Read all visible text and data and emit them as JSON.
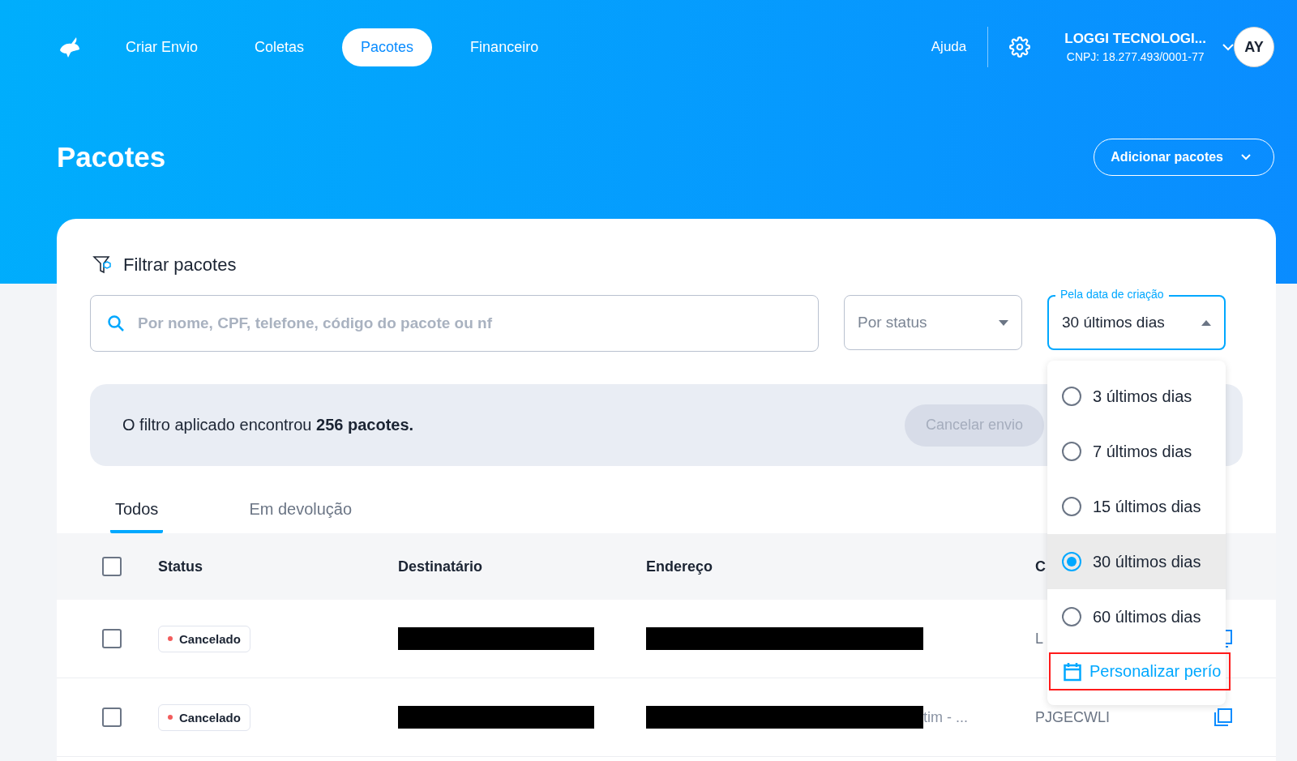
{
  "nav": {
    "items": [
      {
        "label": "Criar Envio",
        "selected": false
      },
      {
        "label": "Coletas",
        "selected": false
      },
      {
        "label": "Pacotes",
        "selected": true
      },
      {
        "label": "Financeiro",
        "selected": false
      }
    ],
    "help": "Ajuda",
    "company": {
      "name": "LOGGI TECNOLOGI...",
      "cnpj": "CNPJ: 18.277.493/0001-77"
    },
    "avatar": "AY"
  },
  "page": {
    "title": "Pacotes",
    "add_button": "Adicionar pacotes"
  },
  "filter": {
    "title": "Filtrar pacotes",
    "search": {
      "placeholder": "Por nome, CPF, telefone, código do pacote ou nf"
    },
    "status_select": {
      "placeholder": "Por status"
    },
    "date_select": {
      "label": "Pela data de criação",
      "value": "30 últimos dias",
      "expanded": true,
      "options": [
        {
          "label": "3 últimos dias",
          "selected": false
        },
        {
          "label": "7 últimos dias",
          "selected": false
        },
        {
          "label": "15 últimos dias",
          "selected": false
        },
        {
          "label": "30 últimos dias",
          "selected": true
        },
        {
          "label": "60 últimos dias",
          "selected": false
        }
      ],
      "custom": {
        "label": "Personalizar perío",
        "highlighted": true
      }
    }
  },
  "result": {
    "text": "O filtro aplicado encontrou **256 pacotes.**",
    "cancel_button": {
      "label": "Cancelar envio",
      "disabled": true
    }
  },
  "tabs": [
    {
      "label": "Todos",
      "selected": true
    },
    {
      "label": "Em devolução",
      "selected": false
    }
  ],
  "table": {
    "header_checked": false,
    "columns": [
      "Status",
      "Destinatário",
      "Endereço",
      "C"
    ],
    "rows": [
      {
        "checked": false,
        "status": "Cancelado",
        "recipient": {
          "redacted": true
        },
        "address": {
          "redacted": true
        },
        "code": "L"
      },
      {
        "checked": false,
        "status": "Cancelado",
        "recipient": {
          "redacted": true
        },
        "address": {
          "redacted": true,
          "text": "tim - ..."
        },
        "code": "PJGECWLI"
      }
    ]
  }
}
